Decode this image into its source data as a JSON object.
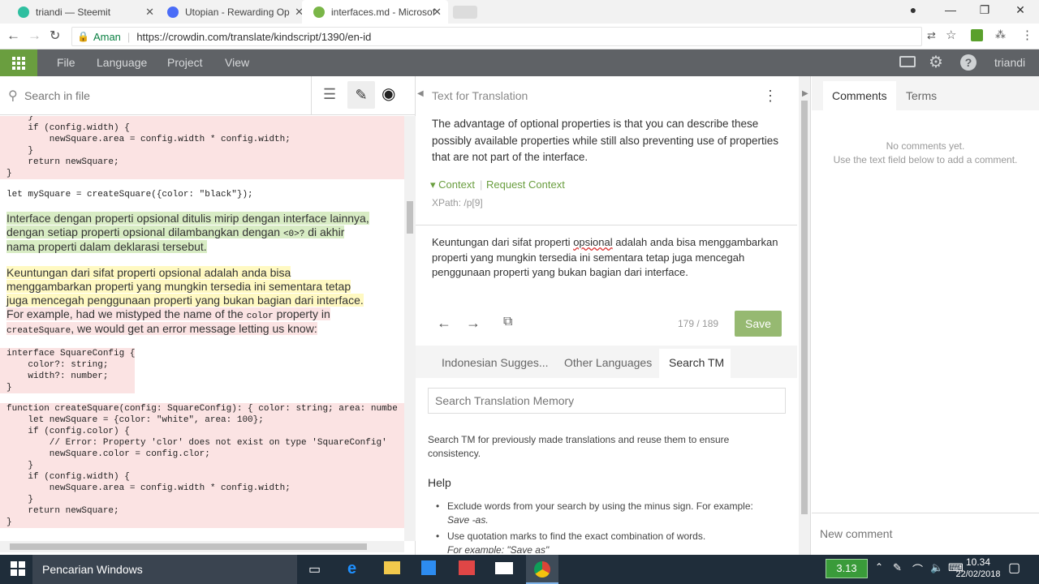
{
  "tabs": [
    {
      "title": "triandi — Steemit",
      "color": "#2fbfa0"
    },
    {
      "title": "Utopian - Rewarding Op",
      "color": "#4a6cf7"
    },
    {
      "title": "interfaces.md - Microsof",
      "color": "#7ab648"
    }
  ],
  "address": {
    "secure": "Aman",
    "url": "https://crowdin.com/translate/kindscript/1390/en-id"
  },
  "menu": {
    "file": "File",
    "language": "Language",
    "project": "Project",
    "view": "View",
    "user": "triandi"
  },
  "left": {
    "search_placeholder": "Search in file",
    "code1": "    }\n    if (config.width) {\n        newSquare.area = config.width * config.width;\n    }\n    return newSquare;\n}",
    "code2": "let mySquare = createSquare({color: \"black\"});",
    "para1a": "Interface dengan properti opsional ditulis mirip dengan interface lainnya,",
    "para1b": "dengan setiap properti opsional dilambangkan dengan",
    "para1code": "<0>?",
    "para1c": "di akhir",
    "para1d": "nama properti dalam deklarasi tersebut.",
    "para2a": "Keuntungan dari sifat properti opsional adalah anda bisa",
    "para2b": "menggambarkan properti yang mungkin tersedia ini sementara tetap",
    "para2c": "juga mencegah penggunaan properti yang bukan bagian dari interface.",
    "para2d": "For example, had we mistyped the name of the",
    "para2code": "color",
    "para2e": "property in",
    "para2code2": "createSquare",
    "para2f": ", we would get an error message letting us know:",
    "code3": "interface SquareConfig {\n    color?: string;\n    width?: number;\n}",
    "code4": "function createSquare(config: SquareConfig): { color: string; area: numbe\n    let newSquare = {color: \"white\", area: 100};\n    if (config.color) {\n        // Error: Property 'clor' does not exist on type 'SquareConfig'\n        newSquare.color = config.clor;\n    }\n    if (config.width) {\n        newSquare.area = config.width * config.width;\n    }\n    return newSquare;\n}"
  },
  "mid": {
    "header": "Text for Translation",
    "source": "The advantage of optional properties is that you can describe these possibly available properties while still also preventing use of properties that are not part of the interface.",
    "context": "Context",
    "request_context": "Request Context",
    "xpath": "XPath: /p[9]",
    "translation_a": "Keuntungan dari sifat properti",
    "translation_err": "opsional",
    "translation_b": "adalah anda bisa menggambarkan properti yang mungkin tersedia ini sementara tetap juga mencegah penggunaan properti yang bukan bagian dari interface.",
    "counter": "179 / 189",
    "save": "Save",
    "tabs": [
      "Indonesian Sugges...",
      "Other Languages",
      "Search TM"
    ],
    "tm_placeholder": "Search Translation Memory",
    "tm_desc": "Search TM for previously made translations and reuse them to ensure consistency.",
    "help_title": "Help",
    "help1a": "Exclude words from your search by using the minus sign. For example:",
    "help1b": "Save -as.",
    "help2": "Use quotation marks to find the exact combination of words.",
    "help3": "For example: \"Save as\""
  },
  "right": {
    "tab_comments": "Comments",
    "tab_terms": "Terms",
    "no_comments": "No comments yet.",
    "hint": "Use the text field below to add a comment.",
    "new_comment": "New comment"
  },
  "taskbar": {
    "search": "Pencarian Windows",
    "badge": "3.13",
    "time": "10.34",
    "date": "22/02/2018"
  }
}
